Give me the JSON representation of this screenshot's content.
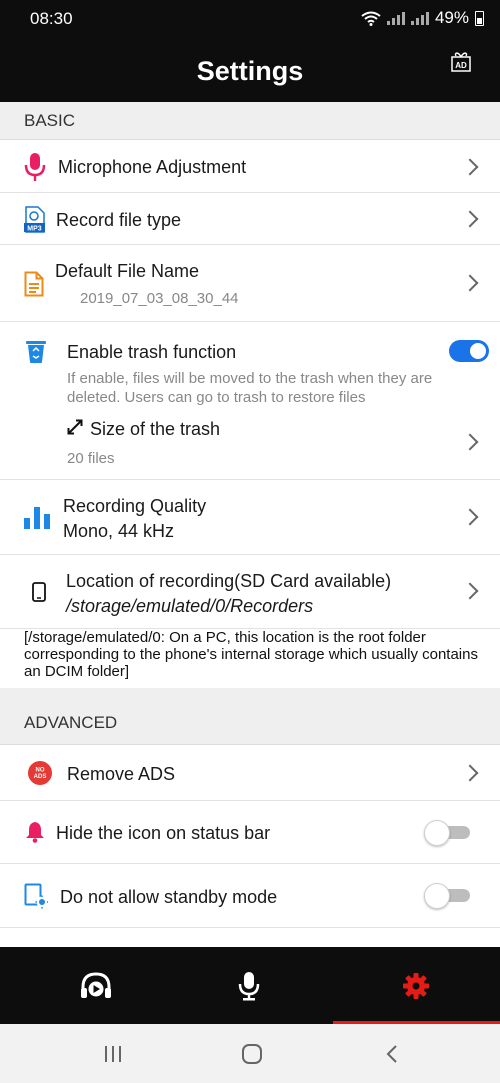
{
  "status_bar": {
    "time": "08:30",
    "battery": "49%"
  },
  "app_bar": {
    "title": "Settings",
    "ad_label": "AD"
  },
  "basic": {
    "header": "BASIC",
    "microphone": {
      "title": "Microphone Adjustment"
    },
    "file_type": {
      "title": "Record file type",
      "icon_label": "MP3"
    },
    "file_name": {
      "title": "Default File Name",
      "value": "2019_07_03_08_30_44"
    },
    "trash": {
      "title": "Enable trash function",
      "enabled": true,
      "description_line1": "If enable, files will be moved to the trash when they are",
      "description_line2": "deleted. Users can go to trash to restore files",
      "size_title": "Size of the trash",
      "size_value": "20 files"
    },
    "quality": {
      "title": "Recording Quality",
      "value": "Mono,  44 kHz"
    },
    "location": {
      "title": "Location of recording(SD Card available)",
      "value": "/storage/emulated/0/Recorders"
    },
    "location_note": "[/storage/emulated/0: On a PC, this location is the root folder corresponding to the phone's internal storage which usually contains an DCIM folder]"
  },
  "advanced": {
    "header": "ADVANCED",
    "remove_ads": {
      "title": "Remove ADS",
      "icon_label_top": "NO",
      "icon_label_bottom": "ADS"
    },
    "hide_icon": {
      "title": "Hide the icon on status bar",
      "enabled": false
    },
    "standby": {
      "title": "Do not allow standby mode",
      "enabled": false
    }
  },
  "bottom_nav": {
    "items": [
      "player-icon",
      "microphone-icon",
      "gear-icon"
    ],
    "active": "gear-icon"
  },
  "colors": {
    "accent_red": "#e41b17",
    "toggle_blue": "#1a73e8",
    "mic_pink": "#e91e63",
    "chart_blue": "#1e88e5",
    "file_orange": "#ef8a17"
  }
}
